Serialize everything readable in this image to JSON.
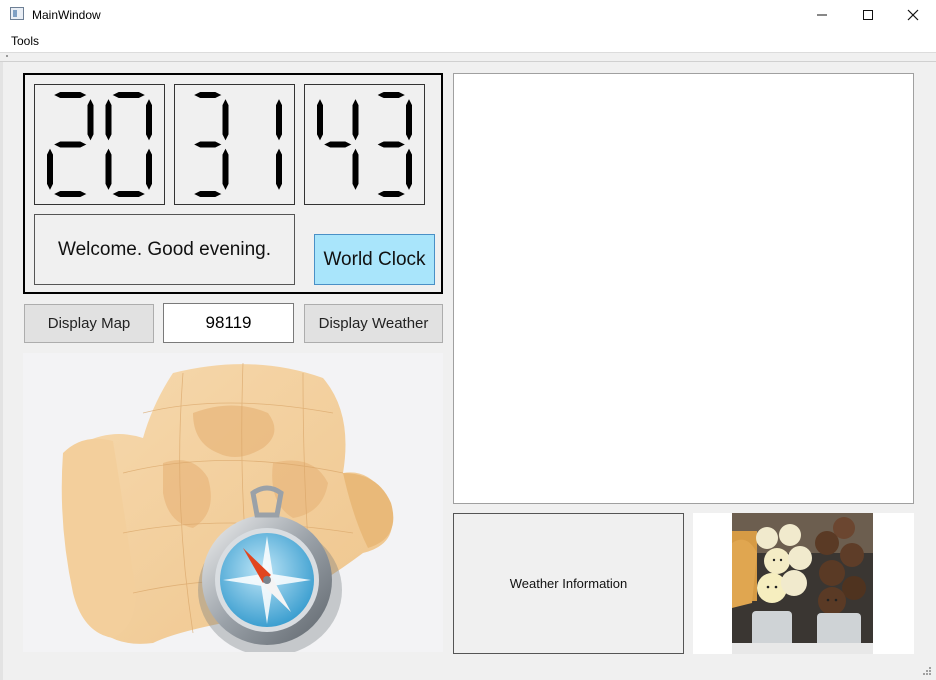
{
  "window": {
    "title": "MainWindow",
    "controls": [
      "minimize-icon",
      "maximize-icon",
      "close-icon"
    ]
  },
  "menu": {
    "items": [
      {
        "label": "Tools"
      }
    ]
  },
  "clock": {
    "hours": "20",
    "minutes": "31",
    "seconds": "43",
    "greeting": "Welcome. Good evening.",
    "world_clock_label": "World Clock"
  },
  "controls": {
    "display_map_label": "Display Map",
    "zip_value": "98119",
    "display_weather_label": "Display Weather"
  },
  "weather": {
    "info_label": "Weather Information"
  },
  "colors": {
    "accent": "#a9e5fb",
    "accent_border": "#4a90c6",
    "button_bg": "#e1e1e1",
    "window_bg": "#f0f0f0"
  },
  "images": {
    "map": "map-with-compass",
    "photo": "bear-cream-puffs"
  }
}
